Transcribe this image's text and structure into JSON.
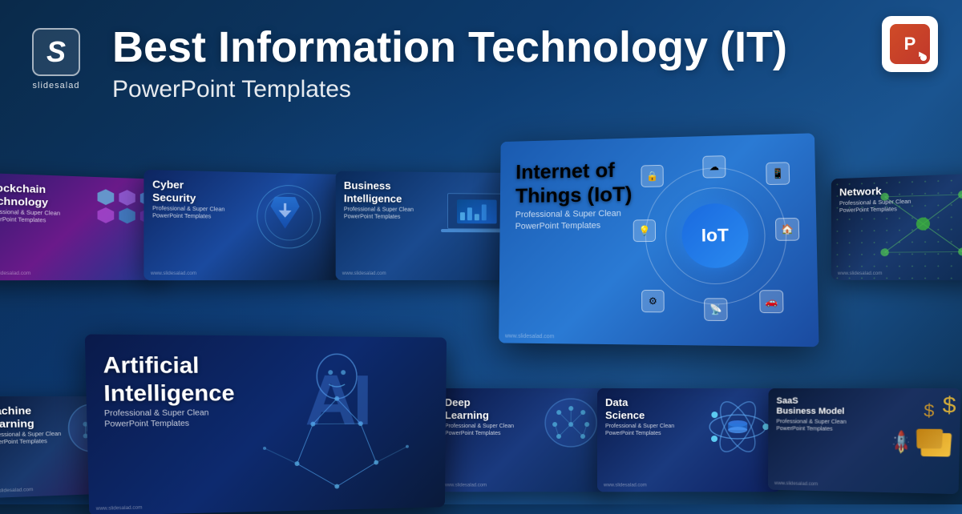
{
  "site": {
    "logo_letter": "S",
    "logo_name": "slidesalad"
  },
  "header": {
    "main_title": "Best Information Technology (IT)",
    "sub_title": "PowerPoint Templates"
  },
  "ppt_icon": {
    "label": "P►"
  },
  "slides": [
    {
      "id": "blockchain",
      "title": "Blockchain\nTechnology",
      "subtitle": "Professional & Super Clean\nPowerPoint Templates",
      "watermark": "www.slidesalad.com"
    },
    {
      "id": "cyber",
      "title": "Cyber\nSecurity",
      "subtitle": "Professional & Super Clean\nPowerPoint Templates",
      "watermark": "www.slidesalad.com"
    },
    {
      "id": "bi",
      "title": "Business\nIntelligence",
      "subtitle": "Professional & Super Clean\nPowerPoint Templates",
      "watermark": "www.slidesalad.com"
    },
    {
      "id": "iot",
      "title": "Internet of\nThings (IoT)",
      "subtitle": "Professional & Super Clean\nPowerPoint Templates",
      "center_label": "IoT",
      "watermark": "www.slidesalad.com"
    },
    {
      "id": "network",
      "title": "Network",
      "subtitle": "Professional & Super Clean\nPowerPoint Templates",
      "watermark": "www.slidesalad.com"
    },
    {
      "id": "ml",
      "title": "Machine\nLearning",
      "subtitle": "Professional & Super Clean\nPowerPoint Templates",
      "watermark": "www.slidesalad.com"
    },
    {
      "id": "ai",
      "title": "Artificial\nIntelligence",
      "subtitle": "Professional & Super Clean\nPowerPoint Templates",
      "ai_label": "AI",
      "watermark": "www.slidesalad.com"
    },
    {
      "id": "dl",
      "title": "Deep\nLearning",
      "subtitle": "Professional & Super Clean\nPowerPoint Templates",
      "watermark": "www.slidesalad.com"
    },
    {
      "id": "ds",
      "title": "Data\nScience",
      "subtitle": "Professional & Super Clean\nPowerPoint Templates",
      "watermark": "www.slidesalad.com"
    },
    {
      "id": "saas",
      "title": "SaaS\nBusiness Model",
      "subtitle": "Professional & Super Clean\nPowerPoint Templates",
      "watermark": "www.slidesalad.com"
    }
  ]
}
